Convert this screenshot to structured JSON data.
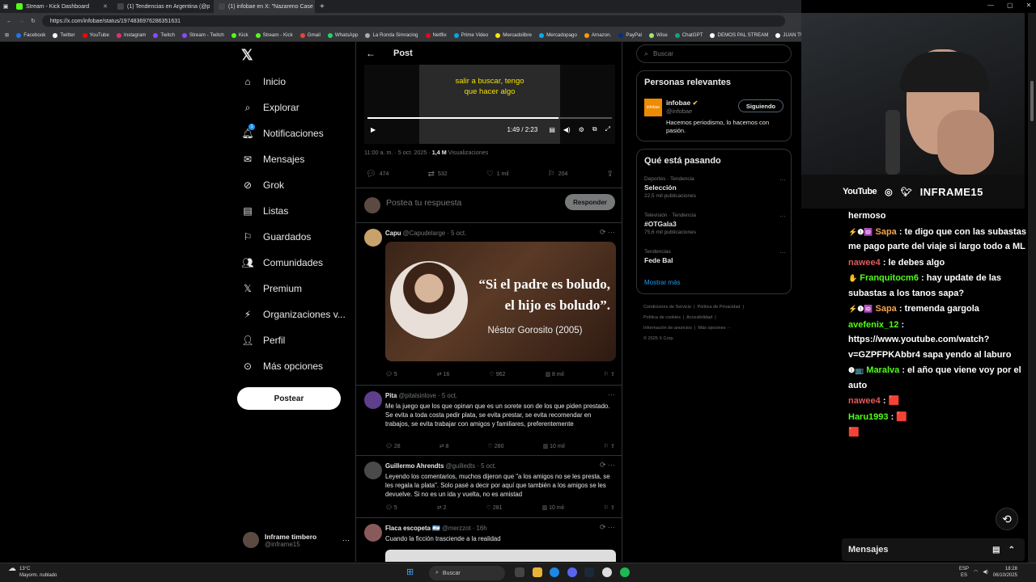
{
  "browser": {
    "tabs": [
      {
        "title": "Stream - Kick Dashboard",
        "color": "#53fc18"
      },
      {
        "title": "(1) Tendencias en Argentina (@p",
        "color": "#fff"
      },
      {
        "title": "(1) infobae en X: \"Nazareno Case",
        "color": "#fff"
      }
    ],
    "url": "https://x.com/infobae/status/1974836976286351631",
    "bookmarks": [
      "Facebook",
      "Twitter",
      "YouTube",
      "Instagram",
      "Twitch",
      "Stream - Twitch",
      "Kick",
      "Stream - Kick",
      "Gmail",
      "WhatsApp",
      "La Ronda Simracing",
      "Netflix",
      "Prime Video",
      "Mercadolibre",
      "Mercadopago",
      "Amazon.",
      "PayPal",
      "Wise",
      "ChatGPT",
      "DEMOS PAL STREAM",
      "JUAN TUR"
    ]
  },
  "nav": {
    "items": [
      "Inicio",
      "Explorar",
      "Notificaciones",
      "Mensajes",
      "Grok",
      "Listas",
      "Guardados",
      "Comunidades",
      "Premium",
      "Organizaciones v...",
      "Perfil",
      "Más opciones"
    ],
    "icons": [
      "home-icon",
      "search-icon",
      "bell-icon",
      "mail-icon",
      "grok-icon",
      "list-icon",
      "bookmark-icon",
      "communities-icon",
      "x-premium-icon",
      "lightning-icon",
      "person-icon",
      "more-circle-icon"
    ],
    "notification_badge": "1",
    "post_label": "Postear",
    "profile_name": "Inframe timbero",
    "profile_handle": "@inframe15"
  },
  "post": {
    "header": "Post",
    "subtitle": "salir a buscar, tengo\nque hacer algo",
    "video_time": "1:49 / 2:23",
    "progress": 0.78,
    "meta_time": "11:00 a. m. · 5 oct. 2025 · ",
    "views": "1,4 M",
    "views_label": "Visualizaciones",
    "replies": "474",
    "reposts": "532",
    "likes": "1 mil",
    "bookmarks": "204",
    "reply_placeholder": "Postea tu respuesta",
    "reply_button": "Responder"
  },
  "tweets": [
    {
      "name": "Capu",
      "handle": "@Capudelarge · 5 oct.",
      "image_quote": "“Si el padre es boludo,\nel hijo es boludo”.",
      "image_author": "Néstor Gorosito (2005)",
      "replies": "5",
      "reposts": "16",
      "likes": "962",
      "views": "8 mil"
    },
    {
      "name": "Pita",
      "handle": "@pitalsinlove · 5 oct.",
      "text": "Me la juego que los que opinan que es un sorete son de los que piden prestado. Se evita a toda costa pedir plata, se evita prestar, se evita recomendar en trabajos, se evita trabajar con amigos y familiares, preferentemente",
      "replies": "28",
      "reposts": "8",
      "likes": "280",
      "views": "10 mil"
    },
    {
      "name": "Guillermo Ahrendts",
      "handle": "@guilledts · 5 oct.",
      "text": "Leyendo los comentarios, muchos dijeron que \"a los amigos no se les presta, se les regala la plata\". Solo pasé a decir por aquí que también a los amigos se les devuelve. Si no es un ida y vuelta, no es amistad",
      "replies": "5",
      "reposts": "2",
      "likes": "281",
      "views": "10 mil"
    },
    {
      "name": "Flaca escopeta 🇦🇷",
      "handle": "@merzzot · 16h",
      "text": "Cuando la ficción trasciende a la realidad"
    }
  ],
  "right": {
    "search_placeholder": "Buscar",
    "relevant_title": "Personas relevantes",
    "account_name": "infobae",
    "account_handle": "@infobae",
    "account_bio": "Hacemos periodismo, lo hacemos con pasión.",
    "follow_label": "Siguiendo",
    "whats_happening": "Qué está pasando",
    "trends": [
      {
        "category": "Deportes · Tendencia",
        "name": "Selección",
        "count": "22,5 mil publicaciones"
      },
      {
        "category": "Televisión · Tendencia",
        "name": "#OTGala3",
        "count": "75,6 mil publicaciones"
      },
      {
        "category": "Tendencias",
        "name": "Fede Bal",
        "count": ""
      }
    ],
    "show_more": "Mostrar más",
    "footer": [
      "Condiciones de Servicio",
      "Política de Privacidad",
      "Política de cookies",
      "Accesibilidad",
      "Información de anuncios",
      "Más opciones ···",
      "© 2025 X Corp."
    ]
  },
  "stream": {
    "youtube": "YouTube",
    "channel": "INFRAME15",
    "chat": [
      {
        "user": "",
        "text": "hermoso",
        "color": "#ffffff",
        "badge": ""
      },
      {
        "user": "Sapa",
        "text": ": te digo que con las subastas me pago parte del viaje si largo todo a ML",
        "color": "#f6a34b",
        "badge": "⚡❶🆔"
      },
      {
        "user": "nawee4",
        "text": ": le debes algo",
        "color": "#e05a5a",
        "badge": ""
      },
      {
        "user": "Franquitocm6",
        "text": ": hay update de las subastas a los tanos sapa?",
        "color": "#53fc18",
        "badge": "✋"
      },
      {
        "user": "Sapa",
        "text": ": tremenda gargola",
        "color": "#f6a34b",
        "badge": "⚡❶🆔"
      },
      {
        "user": "avefenix_12",
        "text": ": https://www.youtube.com/watch?v=GZPFPKAbbr4 sapa yendo al laburo",
        "color": "#53fc18",
        "badge": ""
      },
      {
        "user": "Maralva",
        "text": ": el año que viene voy por el auto",
        "color": "#53fc18",
        "badge": "❶📺"
      },
      {
        "user": "nawee4",
        "text": ": 🟥",
        "color": "#e05a5a",
        "badge": ""
      },
      {
        "user": "Haru1993",
        "text": ": 🟥",
        "color": "#53fc18",
        "badge": ""
      },
      {
        "user": "",
        "text": "🟥",
        "color": "#ffffff",
        "badge": ""
      }
    ],
    "messages_label": "Mensajes"
  },
  "taskbar": {
    "temp": "13°C",
    "weather": "Mayorm. nublado",
    "search": "Buscar",
    "lang1": "ESP",
    "lang2": "ES",
    "time": "18:28",
    "date": "06/10/2025"
  }
}
